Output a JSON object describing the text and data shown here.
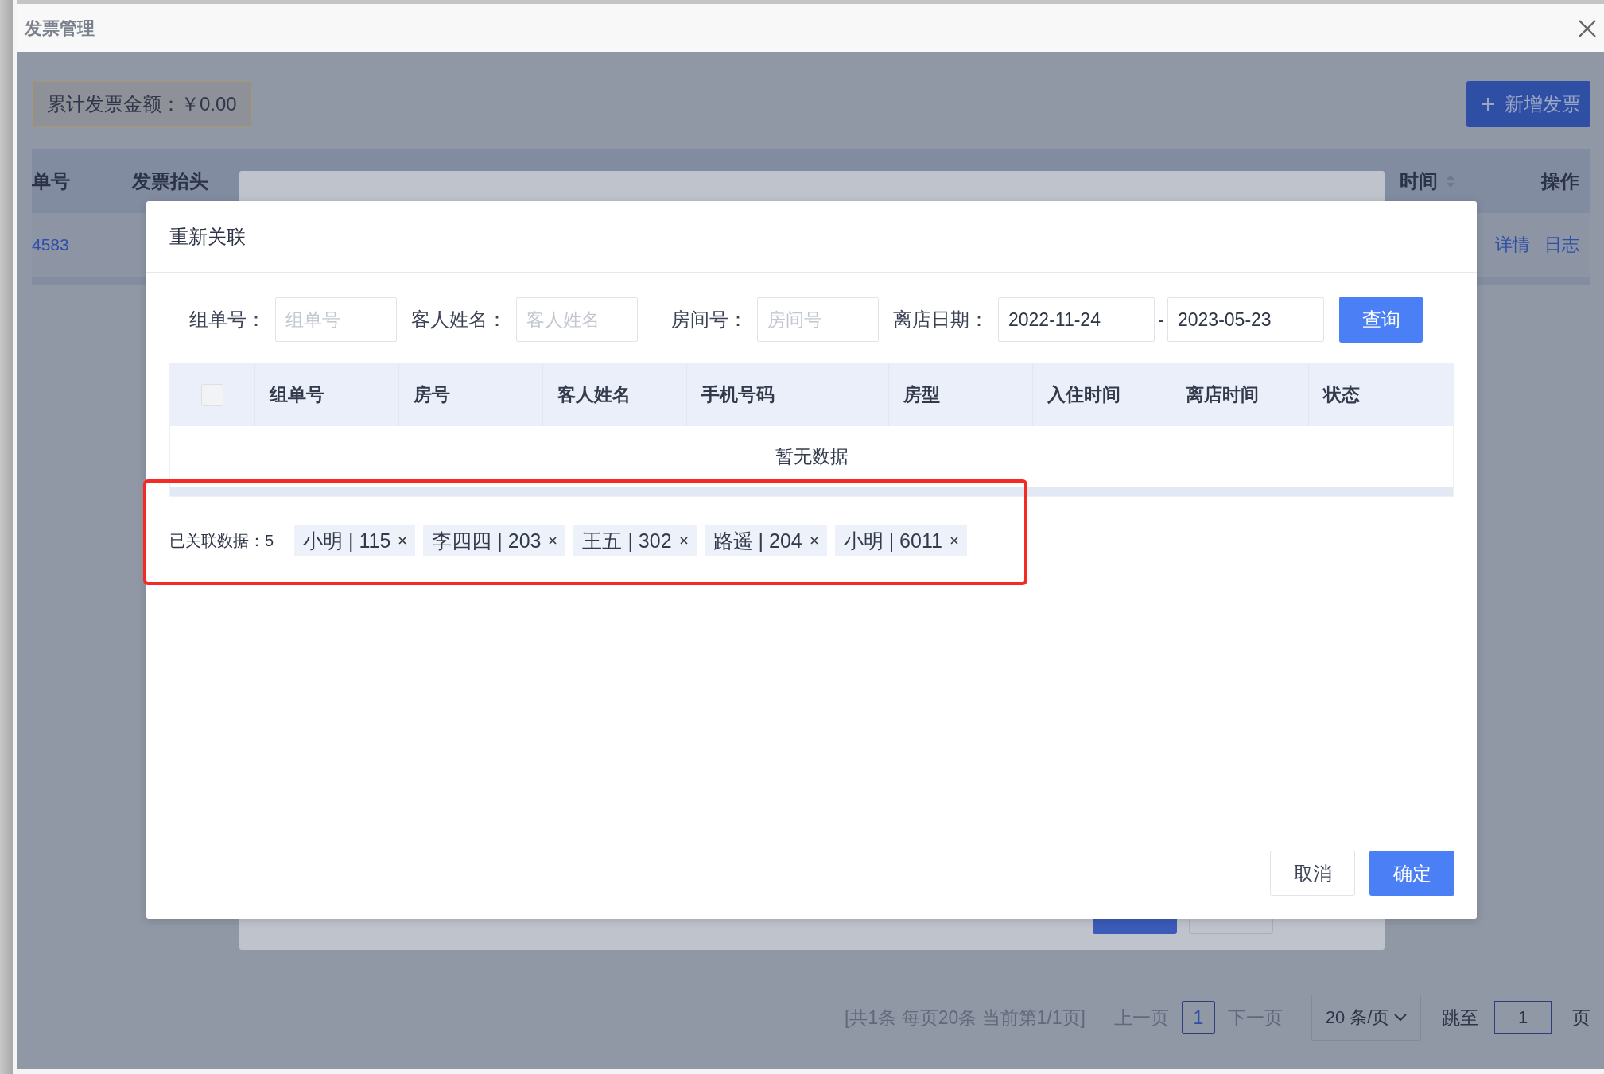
{
  "window": {
    "title": "发票管理"
  },
  "summary": {
    "text": "累计发票金额：￥0.00"
  },
  "add_button": {
    "label": "新增发票"
  },
  "invoice_table": {
    "columns": [
      {
        "label": "单号",
        "sortable": false
      },
      {
        "label": "发票抬头",
        "sortable": false
      },
      {
        "label": "时间",
        "sortable": true
      },
      {
        "label": "操作",
        "sortable": false
      }
    ],
    "rows": [
      {
        "number": "4583",
        "actions": [
          "详情",
          "日志"
        ]
      }
    ]
  },
  "dialog": {
    "title": "重新关联",
    "filters": [
      {
        "label": "组单号：",
        "placeholder": "组单号"
      },
      {
        "label": "客人姓名：",
        "placeholder": "客人姓名"
      },
      {
        "label": "房间号：",
        "placeholder": "房间号"
      }
    ],
    "date": {
      "label": "离店日期：",
      "from": "2022-11-24",
      "separator": "-",
      "to": "2023-05-23"
    },
    "query_button": "查询",
    "table": {
      "select_all_checked": false,
      "columns": [
        "组单号",
        "房号",
        "客人姓名",
        "手机号码",
        "房型",
        "入住时间",
        "离店时间",
        "状态"
      ],
      "empty_text": "暂无数据"
    },
    "linked": {
      "label": "已关联数据：",
      "count": "5",
      "highlighted": true,
      "tags": [
        {
          "text": "小明 | 115"
        },
        {
          "text": "李四四 | 203"
        },
        {
          "text": "王五 | 302"
        },
        {
          "text": "路遥 | 204"
        },
        {
          "text": "小明 | 6011"
        }
      ]
    },
    "buttons": [
      {
        "label": "取消",
        "kind": "default"
      },
      {
        "label": "确定",
        "kind": "primary"
      }
    ]
  },
  "pagination": {
    "summary": "[共1条 每页20条 当前第1/1页]",
    "prev": "上一页",
    "pages": [
      {
        "label": "1",
        "selected": true
      }
    ],
    "next": "下一页",
    "page_size": "20 条/页",
    "jump_label": "跳至",
    "jump_value": "1",
    "page_suffix": "页"
  }
}
